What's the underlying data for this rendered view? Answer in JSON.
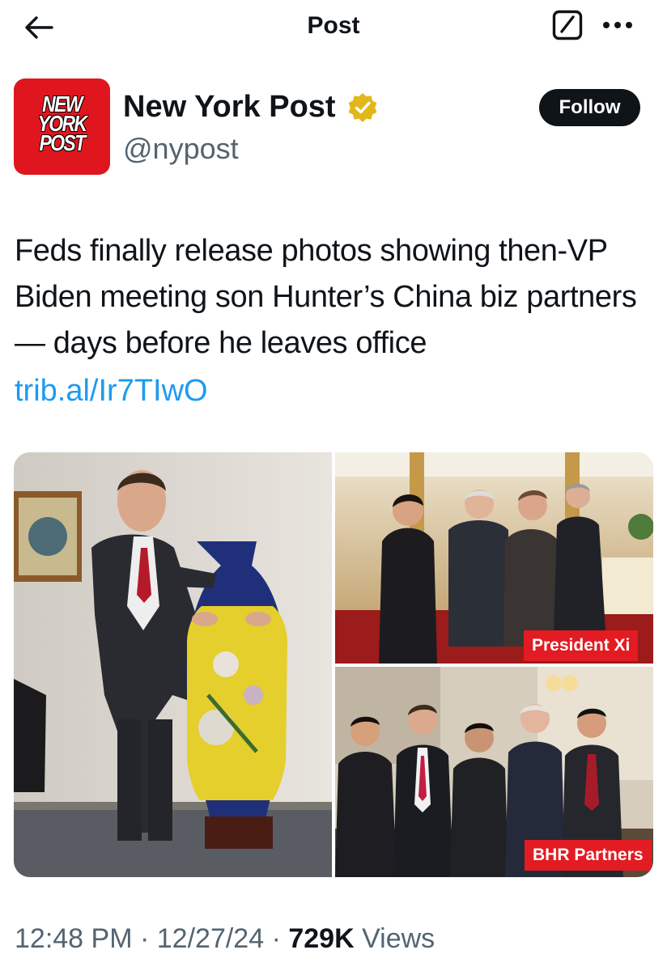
{
  "header": {
    "title": "Post"
  },
  "author": {
    "display_name": "New York Post",
    "handle": "@nypost",
    "logo_lines": [
      "NEW",
      "YORK",
      "POST"
    ],
    "follow_label": "Follow",
    "verified": true
  },
  "post": {
    "text": "Feds finally release photos showing then-VP Biden meeting son Hunter’s China biz partners — days before he leaves office",
    "link": "trib.al/Ir7TIwO"
  },
  "media": {
    "captions": {
      "top_right": "President Xi",
      "bottom_right": "BHR Partners"
    }
  },
  "footer": {
    "time": "12:48 PM",
    "date": "12/27/24",
    "views_count": "729K",
    "views_label": "Views",
    "separator": "·"
  },
  "colors": {
    "accent_link": "#1d9bf0",
    "follow_bg": "#0f1419",
    "brand_red": "#e0161e",
    "verified_gold": "#e2b719",
    "caption_red": "#e31b23",
    "secondary_text": "#536471"
  },
  "icons": [
    "back-arrow-icon",
    "compose-icon",
    "more-icon",
    "verified-badge-icon"
  ]
}
